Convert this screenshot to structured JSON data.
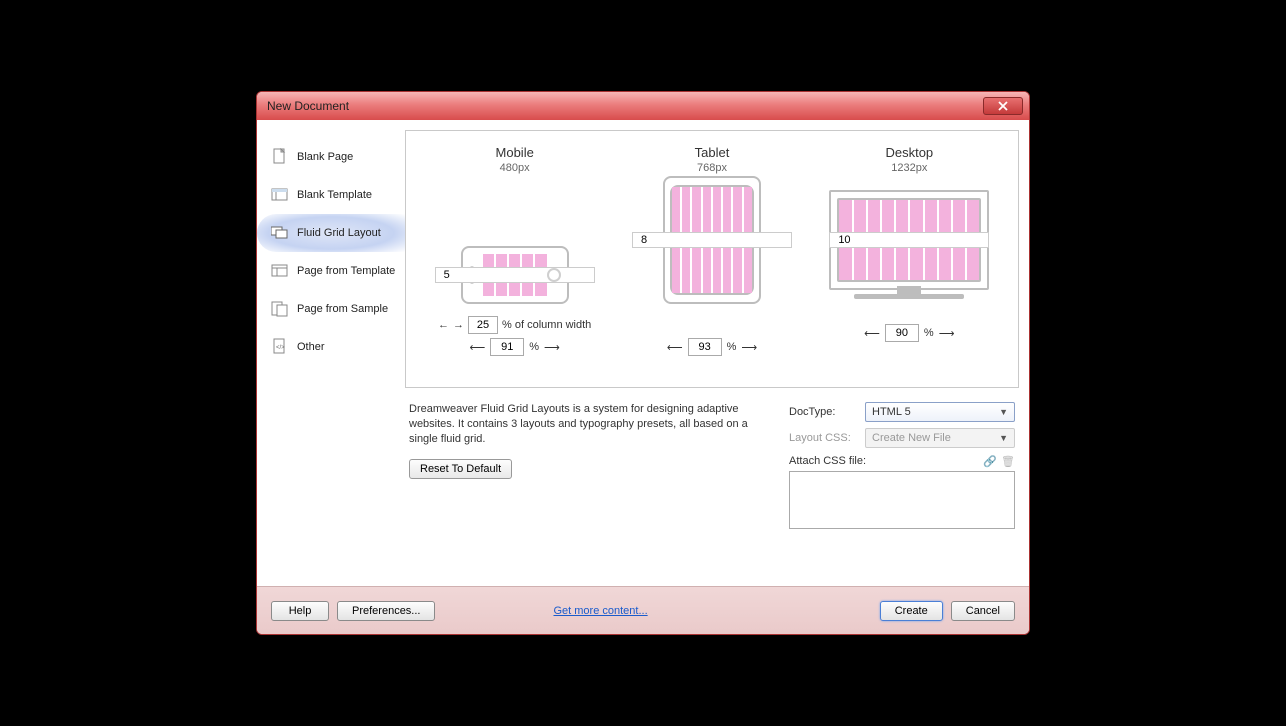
{
  "title": "New Document",
  "sidebar": {
    "items": [
      {
        "label": "Blank Page"
      },
      {
        "label": "Blank Template"
      },
      {
        "label": "Fluid Grid Layout"
      },
      {
        "label": "Page from Template"
      },
      {
        "label": "Page from Sample"
      },
      {
        "label": "Other"
      }
    ]
  },
  "devices": {
    "mobile": {
      "title": "Mobile",
      "px": "480px",
      "cols": "5",
      "pct": "25",
      "pct_label": "% of column width",
      "width": "91"
    },
    "tablet": {
      "title": "Tablet",
      "px": "768px",
      "cols": "8",
      "width": "93"
    },
    "desktop": {
      "title": "Desktop",
      "px": "1232px",
      "cols": "10",
      "width": "90"
    }
  },
  "description": "Dreamweaver Fluid Grid Layouts is a system for designing adaptive websites. It contains 3 layouts and typography presets, all based on a single fluid grid.",
  "reset_label": "Reset To Default",
  "form": {
    "doctype_label": "DocType:",
    "doctype_value": "HTML 5",
    "layoutcss_label": "Layout CSS:",
    "layoutcss_value": "Create New File",
    "attach_label": "Attach CSS file:"
  },
  "footer": {
    "help": "Help",
    "prefs": "Preferences...",
    "more": "Get more content...",
    "create": "Create",
    "cancel": "Cancel"
  },
  "pct_sign": "%"
}
